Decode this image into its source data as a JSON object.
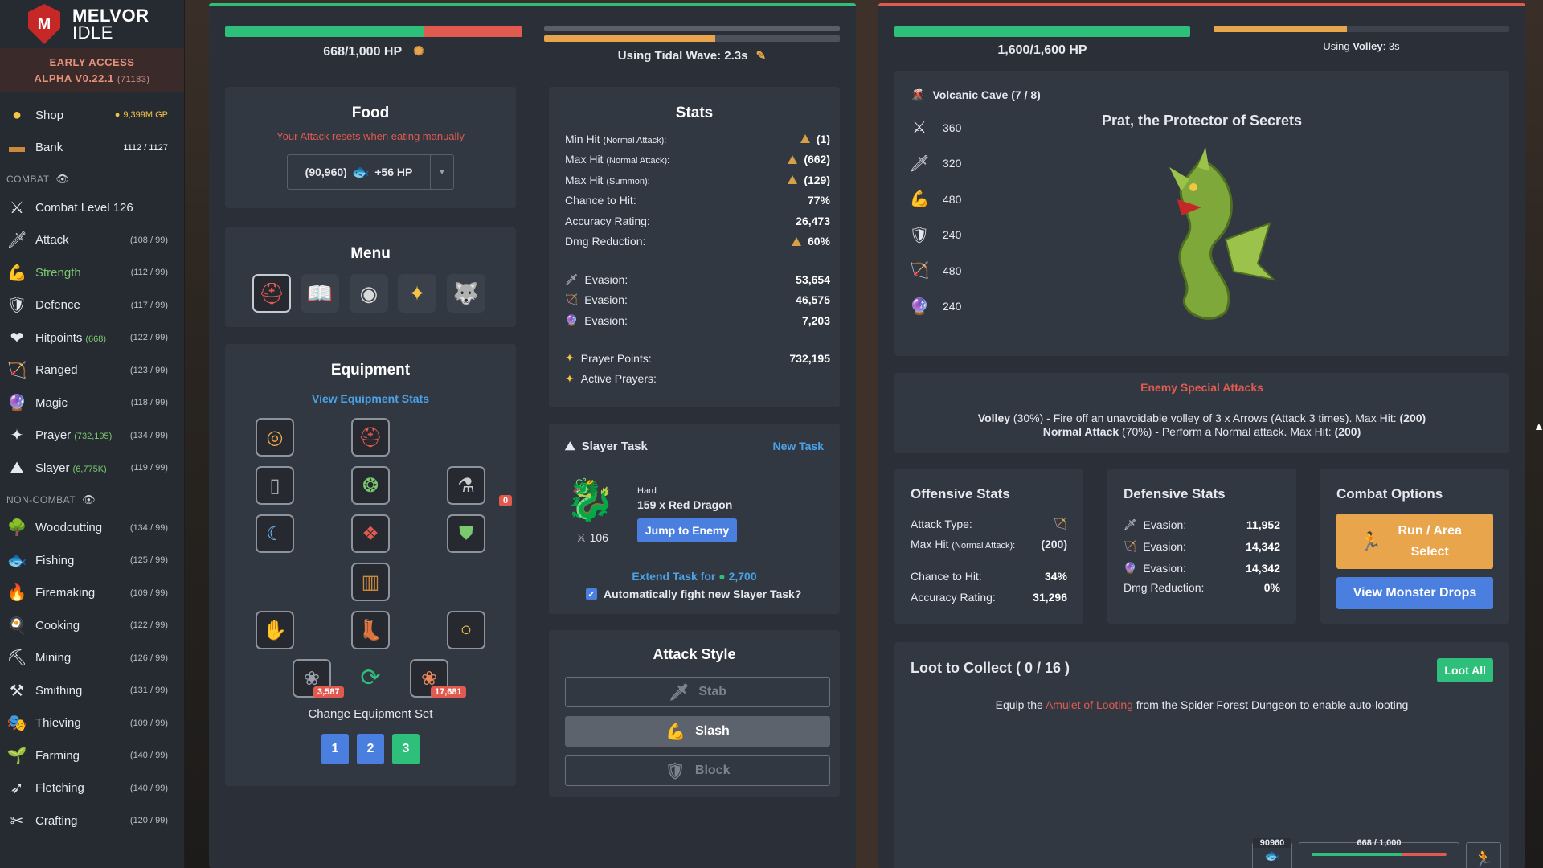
{
  "brand": {
    "name": "MELVOR",
    "name2": "IDLE",
    "access": "EARLY ACCESS",
    "version": "ALPHA V0.22.1",
    "build": "(71183)"
  },
  "sidebar": {
    "shop": {
      "label": "Shop",
      "gp": "9,399M GP"
    },
    "bank": {
      "label": "Bank",
      "count": "1112 / 1127"
    },
    "combat_header": "COMBAT",
    "combat_level": "Combat Level 126",
    "combat": [
      {
        "label": "Attack",
        "sub": "",
        "lv": "(108 / 99)",
        "icon": "🗡"
      },
      {
        "label": "Strength",
        "sub": "",
        "lv": "(112 / 99)",
        "icon": "💪"
      },
      {
        "label": "Defence",
        "sub": "",
        "lv": "(117 / 99)",
        "icon": "🛡"
      },
      {
        "label": "Hitpoints",
        "sub": "(668)",
        "lv": "(122 / 99)",
        "icon": "❤"
      },
      {
        "label": "Ranged",
        "sub": "",
        "lv": "(123 / 99)",
        "icon": "🏹"
      },
      {
        "label": "Magic",
        "sub": "",
        "lv": "(118 / 99)",
        "icon": "🔮"
      },
      {
        "label": "Prayer",
        "sub": "(732,195)",
        "lv": "(134 / 99)",
        "icon": "✦"
      },
      {
        "label": "Slayer",
        "sub": "(6,775K)",
        "lv": "(119 / 99)",
        "icon": "⛰"
      }
    ],
    "noncombat_header": "NON-COMBAT",
    "noncombat": [
      {
        "label": "Woodcutting",
        "lv": "(134 / 99)",
        "icon": "🌳"
      },
      {
        "label": "Fishing",
        "lv": "(125 / 99)",
        "icon": "🐟"
      },
      {
        "label": "Firemaking",
        "lv": "(109 / 99)",
        "icon": "🔥"
      },
      {
        "label": "Cooking",
        "lv": "(122 / 99)",
        "icon": "🍳"
      },
      {
        "label": "Mining",
        "lv": "(126 / 99)",
        "icon": "⛏"
      },
      {
        "label": "Smithing",
        "lv": "(131 / 99)",
        "icon": "⚒"
      },
      {
        "label": "Thieving",
        "lv": "(109 / 99)",
        "icon": "🎭"
      },
      {
        "label": "Farming",
        "lv": "(140 / 99)",
        "icon": "🌱"
      },
      {
        "label": "Fletching",
        "lv": "(140 / 99)",
        "icon": "➶"
      },
      {
        "label": "Crafting",
        "lv": "(120 / 99)",
        "icon": "✂"
      }
    ]
  },
  "player": {
    "hp_text": "668/1,000 HP",
    "hp_fraction": 0.668,
    "attack_text": "Using Tidal Wave: 2.3s",
    "attack_progress": 0.58
  },
  "food": {
    "title": "Food",
    "warning": "Your Attack resets when eating manually",
    "qty": "(90,960)",
    "heal": "+56 HP"
  },
  "menu": {
    "title": "Menu"
  },
  "equipment": {
    "title": "Equipment",
    "view_link": "View Equipment Stats",
    "badge": "0",
    "qty1": "3,587",
    "qty2": "17,681",
    "change_set": "Change Equipment Set",
    "sets": [
      "1",
      "2",
      "3"
    ]
  },
  "stats": {
    "title": "Stats",
    "rows": [
      {
        "k": "Min Hit",
        "small": "(Normal Attack):",
        "v": "(1)",
        "tri": true
      },
      {
        "k": "Max Hit",
        "small": "(Normal Attack):",
        "v": "(662)",
        "tri": true
      },
      {
        "k": "Max Hit",
        "small": "(Summon):",
        "v": "(129)",
        "tri": true
      },
      {
        "k": "Chance to Hit:",
        "small": "",
        "v": "77%",
        "tri": false
      },
      {
        "k": "Accuracy Rating:",
        "small": "",
        "v": "26,473",
        "tri": false
      },
      {
        "k": "Dmg Reduction:",
        "small": "",
        "v": "60%",
        "tri": true
      }
    ],
    "evasion": [
      {
        "icon": "🗡",
        "k": "Evasion:",
        "v": "53,654"
      },
      {
        "icon": "🏹",
        "k": "Evasion:",
        "v": "46,575"
      },
      {
        "icon": "🔮",
        "k": "Evasion:",
        "v": "7,203"
      }
    ],
    "prayer_points_label": "Prayer Points:",
    "prayer_points": "732,195",
    "active_prayers_label": "Active Prayers:"
  },
  "slayer": {
    "title": "Slayer Task",
    "new_task": "New Task",
    "difficulty": "Hard",
    "task": "159 x Red Dragon",
    "jump": "Jump to Enemy",
    "combat_lvl": "106",
    "extend": "Extend Task for",
    "extend_cost": "2,700",
    "auto": "Automatically fight new Slayer Task?"
  },
  "attack_style": {
    "title": "Attack Style",
    "stab": "Stab",
    "slash": "Slash",
    "block": "Block"
  },
  "enemy": {
    "hp_text": "1,600/1,600 HP",
    "hp_fraction": 1.0,
    "attack_prefix": "Using ",
    "attack_name": "Volley",
    "attack_suffix": ": 3s",
    "attack_progress": 0.45,
    "area": "Volcanic Cave (7 / 8)",
    "name": "Prat, the Protector of Secrets",
    "stats": [
      {
        "icon": "⚔",
        "v": "360"
      },
      {
        "icon": "🗡",
        "v": "320"
      },
      {
        "icon": "💪",
        "v": "480"
      },
      {
        "icon": "🛡",
        "v": "240"
      },
      {
        "icon": "🏹",
        "v": "480"
      },
      {
        "icon": "🔮",
        "v": "240"
      }
    ]
  },
  "special": {
    "title": "Enemy Special Attacks",
    "line1_name": "Volley",
    "line1_text": " (30%) - Fire off an unavoidable volley of 3 x Arrows (Attack 3 times). Max Hit: ",
    "line1_max": "(200)",
    "line2_name": "Normal Attack",
    "line2_text": " (70%) - Perform a Normal attack. Max Hit: ",
    "line2_max": "(200)"
  },
  "offensive": {
    "title": "Offensive Stats",
    "attack_type": "Attack Type:",
    "max_hit": "Max Hit",
    "max_hit_small": "(Normal Attack):",
    "max_hit_v": "(200)",
    "chance": "Chance to Hit:",
    "chance_v": "34%",
    "acc": "Accuracy Rating:",
    "acc_v": "31,296"
  },
  "defensive": {
    "title": "Defensive Stats",
    "rows": [
      {
        "icon": "🗡",
        "k": "Evasion:",
        "v": "11,952"
      },
      {
        "icon": "🏹",
        "k": "Evasion:",
        "v": "14,342"
      },
      {
        "icon": "🔮",
        "k": "Evasion:",
        "v": "14,342"
      }
    ],
    "dmg": "Dmg Reduction:",
    "dmg_v": "0%"
  },
  "combat_options": {
    "title": "Combat Options",
    "run": "Run / Area Select",
    "drops": "View Monster Drops"
  },
  "loot": {
    "title": "Loot to Collect ( 0 / 16 )",
    "loot_all": "Loot All",
    "msg_pre": "Equip the ",
    "msg_link": "Amulet of Looting",
    "msg_post": " from the Spider Forest Dungeon to enable auto-looting"
  },
  "minibar": {
    "food": "90960",
    "hp": "668 / 1,000"
  },
  "colors": {
    "green": "#2ec07a",
    "red": "#e05a4f",
    "blue": "#4a7fe0",
    "orange": "#e8a54b",
    "link": "#4aa3e8"
  }
}
